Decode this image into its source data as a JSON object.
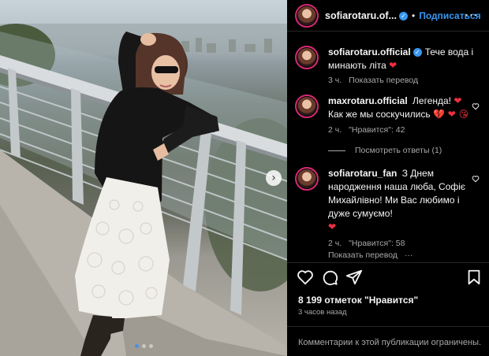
{
  "header": {
    "username": "sofiarotaru.of...",
    "separator": "•",
    "follow_label": "Подписаться",
    "more_label": "···"
  },
  "post": {
    "carousel_next": "›",
    "carousel_total": 3,
    "carousel_active": 1
  },
  "comments": [
    {
      "username": "sofiarotaru.official",
      "verified": true,
      "text": "Тече вода і минають літа",
      "emoji": "❤",
      "time": "3 ч.",
      "translate": "Показать перевод"
    },
    {
      "username": "maxrotaru.official",
      "text": "Легенда!",
      "emoji": "❤",
      "text2": "Как же мы соскучились",
      "emoji2": "💔 ❤ 😘",
      "time": "2 ч.",
      "likes": "\"Нравится\": 42",
      "replies": "Посмотреть ответы (1)"
    },
    {
      "username": "sofiarotaru_fan",
      "text": "З Днем народження наша люба, Софіє Михайлівно! Ми Вас любимо і дуже сумуємо!",
      "emoji": "❤",
      "time": "2 ч.",
      "likes": "\"Нравится\": 58",
      "translate": "Показать перевод"
    }
  ],
  "footer": {
    "likes_count": "8 199 отметок \"Нравится\"",
    "time_ago": "3 часов назад",
    "comments_limited": "Комментарии к этой публикации ограничены."
  },
  "colors": {
    "background": "#000000",
    "link_blue": "#3897f0",
    "heart_red": "#ed2f40",
    "muted_text": "#a8a8a8"
  },
  "icons": [
    "verified-badge-icon",
    "more-options-icon",
    "heart-icon",
    "comment-icon",
    "share-icon",
    "bookmark-icon",
    "chevron-right-icon"
  ]
}
